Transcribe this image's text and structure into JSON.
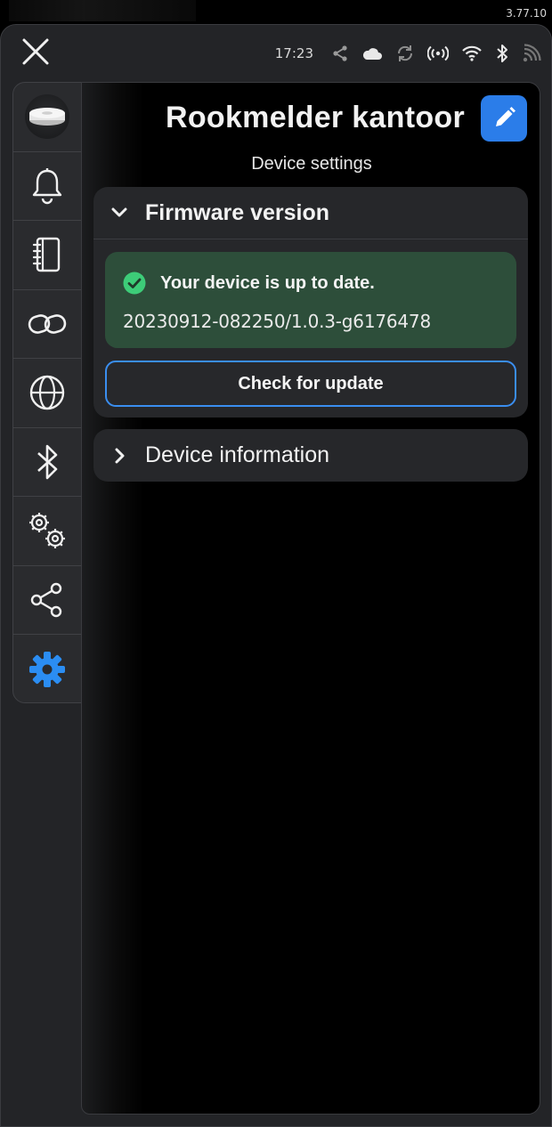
{
  "app": {
    "version": "3.77.10"
  },
  "status_bar": {
    "time": "17:23"
  },
  "header": {
    "title": "Rookmelder kantoor",
    "subtitle": "Device settings"
  },
  "sidebar": {
    "items": [
      {
        "icon": "smoke-detector-icon"
      },
      {
        "icon": "bell-icon"
      },
      {
        "icon": "notebook-icon"
      },
      {
        "icon": "link-icon"
      },
      {
        "icon": "globe-icon"
      },
      {
        "icon": "bluetooth-icon"
      },
      {
        "icon": "gears-icon"
      },
      {
        "icon": "share-icon"
      },
      {
        "icon": "settings-gear-icon",
        "active": true
      }
    ]
  },
  "firmware": {
    "header": "Firmware version",
    "status_message": "Your device is up to date.",
    "version": "20230912-082250/1.0.3-g6176478",
    "check_button": "Check for update"
  },
  "device_info": {
    "header": "Device information"
  },
  "colors": {
    "accent": "#2b7de9",
    "success_bg": "#2d4e3a",
    "success_icon": "#3dcc78",
    "panel_bg": "#232427"
  }
}
